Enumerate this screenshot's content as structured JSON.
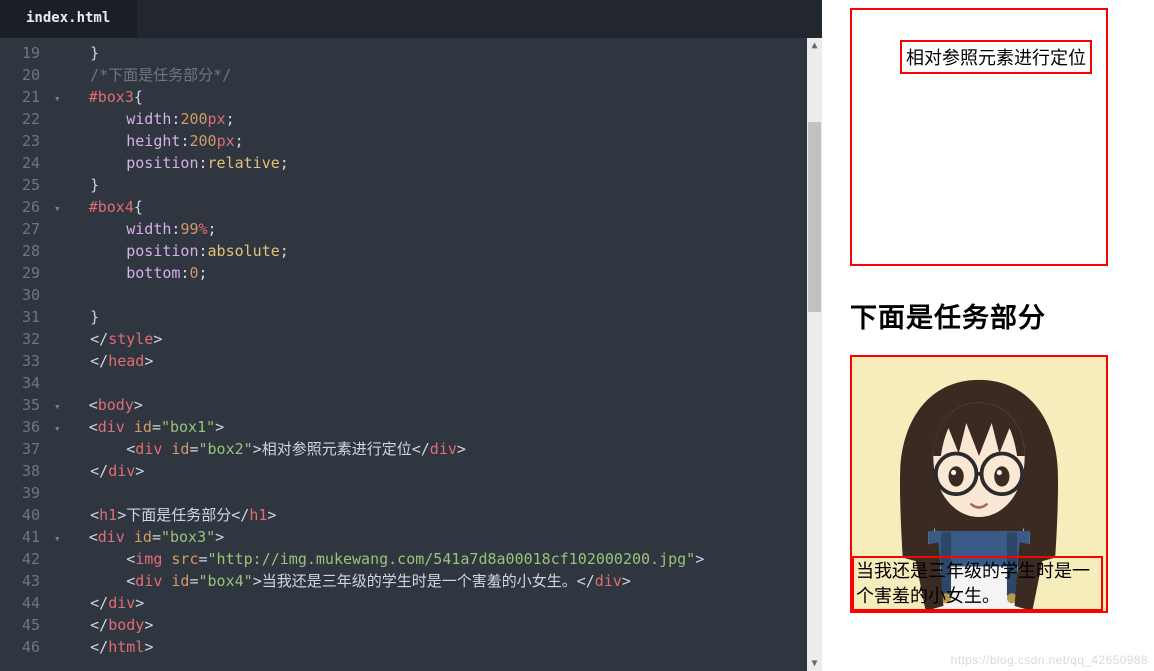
{
  "editor": {
    "tab": "index.html",
    "first_line_no": 19,
    "lines": [
      {
        "t": "punc",
        "s": "    }"
      },
      {
        "t": "comm",
        "s": "    /*下面是任务部分*/"
      },
      {
        "t": "raw",
        "html": "<span class='fold'>▾</span>   <span class='tok-sel'>#box3</span><span class='tok-punc'>{</span>"
      },
      {
        "t": "raw",
        "html": "        <span class='tok-prop'>width</span><span class='tok-punc'>:</span><span class='tok-num'>200</span><span class='tok-unit'>px</span><span class='tok-punc'>;</span>"
      },
      {
        "t": "raw",
        "html": "        <span class='tok-prop'>height</span><span class='tok-punc'>:</span><span class='tok-num'>200</span><span class='tok-unit'>px</span><span class='tok-punc'>;</span>"
      },
      {
        "t": "raw",
        "html": "        <span class='tok-prop'>position</span><span class='tok-punc'>:</span><span class='tok-kw'>relative</span><span class='tok-punc'>;</span>"
      },
      {
        "t": "punc",
        "s": "    }"
      },
      {
        "t": "raw",
        "html": "<span class='fold'>▾</span>   <span class='tok-sel'>#box4</span><span class='tok-punc'>{</span>"
      },
      {
        "t": "raw",
        "html": "        <span class='tok-prop'>width</span><span class='tok-punc'>:</span><span class='tok-num'>99</span><span class='tok-unit'>%</span><span class='tok-punc'>;</span>"
      },
      {
        "t": "raw",
        "html": "        <span class='tok-prop'>position</span><span class='tok-punc'>:</span><span class='tok-kw'>absolute</span><span class='tok-punc'>;</span>"
      },
      {
        "t": "raw",
        "html": "        <span class='tok-prop'>bottom</span><span class='tok-punc'>:</span><span class='tok-num'>0</span><span class='tok-punc'>;</span>"
      },
      {
        "t": "punc",
        "s": ""
      },
      {
        "t": "punc",
        "s": "    }"
      },
      {
        "t": "raw",
        "html": "    <span class='tok-punc'>&lt;/</span><span class='tok-tag'>style</span><span class='tok-punc'>&gt;</span>"
      },
      {
        "t": "raw",
        "html": "    <span class='tok-punc'>&lt;/</span><span class='tok-tag'>head</span><span class='tok-punc'>&gt;</span>"
      },
      {
        "t": "punc",
        "s": ""
      },
      {
        "t": "raw",
        "html": "<span class='fold'>▾</span>   <span class='tok-punc'>&lt;</span><span class='tok-tag'>body</span><span class='tok-punc'>&gt;</span>"
      },
      {
        "t": "raw",
        "html": "<span class='fold'>▾</span>   <span class='tok-punc'>&lt;</span><span class='tok-tag'>div</span> <span class='tok-attr'>id</span><span class='tok-punc'>=</span><span class='tok-str'>\"box1\"</span><span class='tok-punc'>&gt;</span>"
      },
      {
        "t": "raw",
        "html": "        <span class='tok-punc'>&lt;</span><span class='tok-tag'>div</span> <span class='tok-attr'>id</span><span class='tok-punc'>=</span><span class='tok-str'>\"box2\"</span><span class='tok-punc'>&gt;</span><span class='tok-text'>相对参照元素进行定位</span><span class='tok-punc'>&lt;/</span><span class='tok-tag'>div</span><span class='tok-punc'>&gt;</span>"
      },
      {
        "t": "raw",
        "html": "    <span class='tok-punc'>&lt;/</span><span class='tok-tag'>div</span><span class='tok-punc'>&gt;</span>"
      },
      {
        "t": "punc",
        "s": ""
      },
      {
        "t": "raw",
        "html": "    <span class='tok-punc'>&lt;</span><span class='tok-tag'>h1</span><span class='tok-punc'>&gt;</span><span class='tok-text'>下面是任务部分</span><span class='tok-punc'>&lt;/</span><span class='tok-tag'>h1</span><span class='tok-punc'>&gt;</span>"
      },
      {
        "t": "raw",
        "html": "<span class='fold'>▾</span>   <span class='tok-punc'>&lt;</span><span class='tok-tag'>div</span> <span class='tok-attr'>id</span><span class='tok-punc'>=</span><span class='tok-str'>\"box3\"</span><span class='tok-punc'>&gt;</span>"
      },
      {
        "t": "raw",
        "html": "        <span class='tok-punc'>&lt;</span><span class='tok-tag'>img</span> <span class='tok-attr'>src</span><span class='tok-punc'>=</span><span class='tok-str'>\"http://img.mukewang.com/541a7d8a00018cf102000200.jpg\"</span><span class='tok-punc'>&gt;</span>"
      },
      {
        "t": "raw",
        "html": "        <span class='tok-punc'>&lt;</span><span class='tok-tag'>div</span> <span class='tok-attr'>id</span><span class='tok-punc'>=</span><span class='tok-str'>\"box4\"</span><span class='tok-punc'>&gt;</span><span class='tok-text'>当我还是三年级的学生时是一个害羞的小女生。</span><span class='tok-punc'>&lt;/</span><span class='tok-tag'>div</span><span class='tok-punc'>&gt;</span>"
      },
      {
        "t": "raw",
        "html": "    <span class='tok-punc'>&lt;/</span><span class='tok-tag'>div</span><span class='tok-punc'>&gt;</span>"
      },
      {
        "t": "raw",
        "html": "    <span class='tok-punc'>&lt;/</span><span class='tok-tag'>body</span><span class='tok-punc'>&gt;</span>"
      },
      {
        "t": "raw",
        "html": "    <span class='tok-punc'>&lt;/</span><span class='tok-tag'>html</span><span class='tok-punc'>&gt;</span>"
      }
    ]
  },
  "preview": {
    "box2_text": "相对参照元素进行定位",
    "heading": "下面是任务部分",
    "box4_text": "当我还是三年级的学生时是一个害羞的小女生。",
    "watermark": "https://blog.csdn.net/qq_42650988"
  }
}
